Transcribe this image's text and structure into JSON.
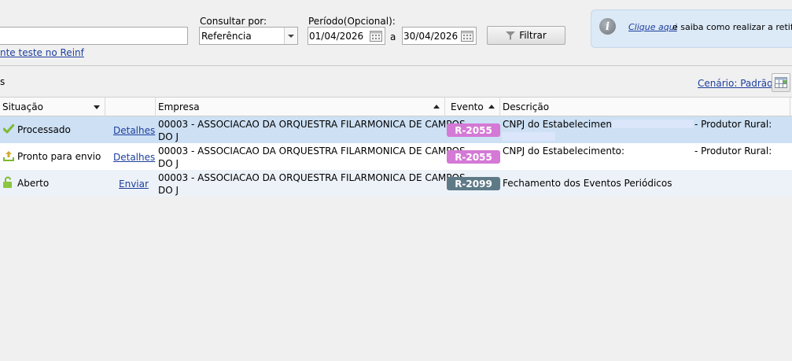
{
  "filters": {
    "env_link": "nte teste no Reinf",
    "consult_label": "Consultar por:",
    "consult_value": "Referência",
    "period_label": "Período(Opcional):",
    "date_from": "01/04/2026",
    "date_sep": "a",
    "date_to": "30/04/2026",
    "filter_button": "Filtrar"
  },
  "info": {
    "link": "Clique aqui",
    "text": "e saiba como realizar a retific"
  },
  "section": {
    "title_fragment": "s",
    "scenario_link": "Cenário: Padrão"
  },
  "columns": {
    "situacao": "Situação",
    "empresa": "Empresa",
    "evento": "Evento",
    "descricao": "Descrição"
  },
  "rows": [
    {
      "status": "Processado",
      "status_icon": "check-icon",
      "action": "Detalhes",
      "empresa_line1": "00003 - ASSOCIACAO DA ORQUESTRA FILARMONICA DE CAMPOS",
      "empresa_line2": "DO J",
      "evento": "R-2055",
      "evento_color": "#d479d6",
      "descricao": "CNPJ do Estabelecimento:",
      "descricao_extra": "- Produtor Rural:"
    },
    {
      "status": "Pronto para envio",
      "status_icon": "upload-icon",
      "action": "Detalhes",
      "empresa_line1": "00003 - ASSOCIACAO DA ORQUESTRA FILARMONICA DE CAMPOS",
      "empresa_line2": "DO J",
      "evento": "R-2055",
      "evento_color": "#d479d6",
      "descricao": "CNPJ do Estabelecimento:",
      "descricao_extra": "- Produtor Rural:"
    },
    {
      "status": "Aberto",
      "status_icon": "unlock-icon",
      "action": "Enviar",
      "empresa_line1": "00003 - ASSOCIACAO DA ORQUESTRA FILARMONICA DE CAMPOS",
      "empresa_line2": "DO J",
      "evento": "R-2099",
      "evento_color": "#5e7a87",
      "descricao": "Fechamento dos Eventos Periódicos",
      "descricao_extra": ""
    }
  ]
}
